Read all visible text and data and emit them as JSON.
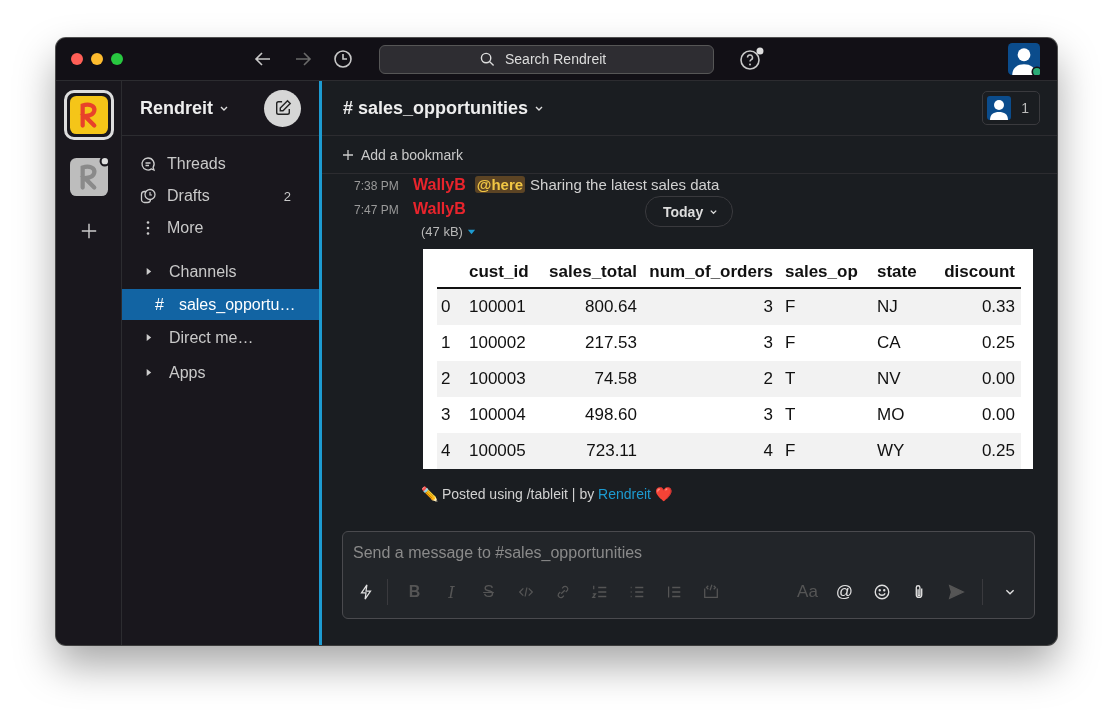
{
  "toolbar": {
    "search": {
      "placeholder": "Search Rendreit"
    }
  },
  "workspaces": [
    {
      "selected": true,
      "unread": false
    },
    {
      "selected": false,
      "unread": true
    }
  ],
  "sidebar": {
    "workspace": "Rendreit",
    "nav": [
      {
        "kind": "threads",
        "label": "Threads"
      },
      {
        "kind": "drafts",
        "label": "Drafts",
        "count": "2"
      },
      {
        "kind": "more",
        "label": "More"
      }
    ],
    "sections": [
      {
        "label": "Channels",
        "expanded": false,
        "items": [
          {
            "prefix": "#",
            "label": "sales_opportu…",
            "selected": true
          }
        ]
      },
      {
        "label": "Direct me…",
        "expanded": false
      },
      {
        "label": "Apps",
        "expanded": false
      }
    ]
  },
  "channel": {
    "name": "# sales_opportunities",
    "members": "1"
  },
  "bookmark": "Add a bookmark",
  "divider": {
    "label": "Today"
  },
  "messages": [
    {
      "time": "7:38 PM",
      "author": "WallyB",
      "mention": "@here",
      "text": "Sharing the latest sales data"
    },
    {
      "time": "7:47 PM",
      "author": "WallyB",
      "file_size": "(47 kB)",
      "table": {
        "columns": [
          {
            "label": "cust_id",
            "numeric": false
          },
          {
            "label": "sales_total",
            "numeric": true
          },
          {
            "label": "num_of_orders",
            "numeric": true
          },
          {
            "label": "sales_op",
            "numeric": false
          },
          {
            "label": "state",
            "numeric": false
          },
          {
            "label": "discount",
            "numeric": true
          }
        ],
        "rows": [
          {
            "index": "0",
            "cells": [
              "100001",
              "800.64",
              "3",
              "F",
              "NJ",
              "0.33"
            ]
          },
          {
            "index": "1",
            "cells": [
              "100002",
              "217.53",
              "3",
              "F",
              "CA",
              "0.25"
            ]
          },
          {
            "index": "2",
            "cells": [
              "100003",
              "74.58",
              "2",
              "T",
              "NV",
              "0.00"
            ]
          },
          {
            "index": "3",
            "cells": [
              "100004",
              "498.60",
              "3",
              "T",
              "MO",
              "0.00"
            ]
          },
          {
            "index": "4",
            "cells": [
              "100005",
              "723.11",
              "4",
              "F",
              "WY",
              "0.25"
            ]
          }
        ]
      },
      "footer": {
        "prefix": "✏️ Posted using /tableit | by",
        "link": "Rendreit",
        "suffix": "❤️"
      }
    }
  ],
  "composer": {
    "placeholder": "Send a message to #sales_opportunities",
    "tools": [
      {
        "kind": "shortcut",
        "disabled": false
      },
      {
        "kind": "bold",
        "label": "B",
        "disabled": true
      },
      {
        "kind": "italic",
        "label": "I",
        "disabled": true
      },
      {
        "kind": "strike",
        "label": "S",
        "disabled": true
      },
      {
        "kind": "code",
        "disabled": true
      },
      {
        "kind": "link",
        "disabled": true
      },
      {
        "kind": "ordered",
        "disabled": true
      },
      {
        "kind": "bullet",
        "disabled": true
      },
      {
        "kind": "quote",
        "disabled": true
      },
      {
        "kind": "codeblock",
        "disabled": true
      }
    ],
    "right_tools": [
      {
        "kind": "format",
        "label": "Aa",
        "disabled": true
      },
      {
        "kind": "mention",
        "label": "@",
        "disabled": false
      },
      {
        "kind": "emoji",
        "disabled": false
      },
      {
        "kind": "attach",
        "disabled": false
      },
      {
        "kind": "send",
        "disabled": true
      },
      {
        "kind": "options",
        "disabled": false
      }
    ]
  }
}
